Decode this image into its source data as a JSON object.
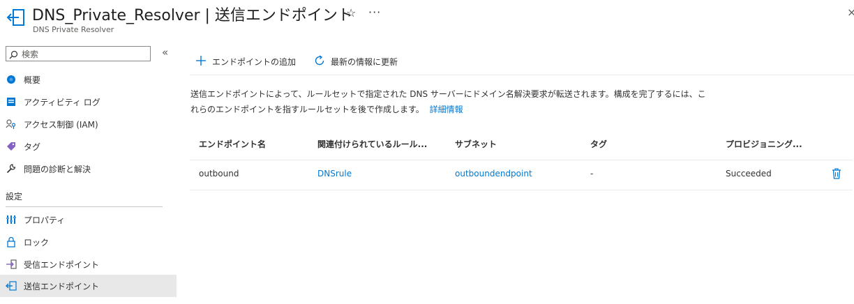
{
  "header": {
    "title": "DNS_Private_Resolver | 送信エンドポイント",
    "subtitle": "DNS Private Resolver",
    "favorite_glyph": "☆",
    "more_glyph": "···",
    "close_glyph": "×"
  },
  "sidebar": {
    "search_placeholder": "検索",
    "collapse_glyph": "«",
    "items": [
      {
        "label": "概要",
        "icon": "overview-icon"
      },
      {
        "label": "アクティビティ ログ",
        "icon": "activity-log-icon"
      },
      {
        "label": "アクセス制御 (IAM)",
        "icon": "access-control-icon"
      },
      {
        "label": "タグ",
        "icon": "tag-icon"
      },
      {
        "label": "問題の診断と解決",
        "icon": "wrench-icon"
      }
    ],
    "section_label": "設定",
    "settings_items": [
      {
        "label": "プロパティ",
        "icon": "properties-icon"
      },
      {
        "label": "ロック",
        "icon": "lock-icon"
      },
      {
        "label": "受信エンドポイント",
        "icon": "inbound-endpoint-icon"
      },
      {
        "label": "送信エンドポイント",
        "icon": "outbound-endpoint-icon",
        "selected": true
      }
    ]
  },
  "toolbar": {
    "add_label": "エンドポイントの追加",
    "refresh_label": "最新の情報に更新"
  },
  "description": {
    "text": "送信エンドポイントによって、ルールセットで指定された DNS サーバーにドメイン名解決要求が転送されます。構成を完了するには、これらのエンドポイントを指すルールセットを後で作成します。",
    "link": "詳細情報"
  },
  "table": {
    "columns": [
      "エンドポイント名",
      "関連付けられているルール...",
      "サブネット",
      "タグ",
      "プロビジョニング..."
    ],
    "rows": [
      {
        "name": "outbound",
        "ruleset": "DNSrule",
        "subnet": "outboundendpoint",
        "tags": "-",
        "state": "Succeeded"
      }
    ]
  },
  "colors": {
    "accent": "#0078d4",
    "selected_bg": "#e8e8e8",
    "text": "#323130",
    "purple": "#8661c5"
  }
}
